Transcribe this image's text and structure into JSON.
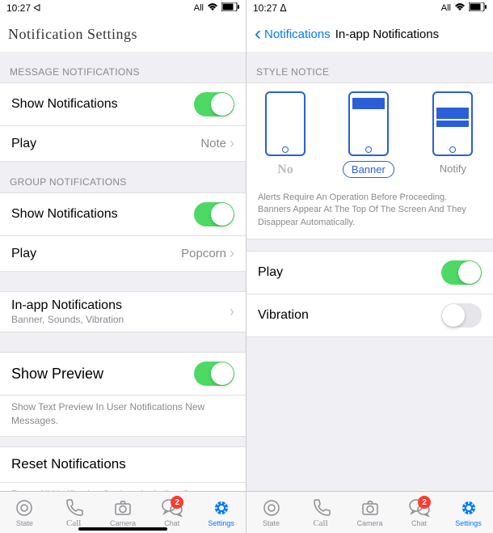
{
  "status": {
    "time_left": "10:27 ᐊ",
    "time_right": "10:27 ᐃ",
    "right": "All"
  },
  "left": {
    "title": "Notification Settings",
    "section1": "MESSAGE NOTIFICATIONS",
    "show_notif1": "Show Notifications",
    "play1_label": "Play",
    "play1_value": "Note",
    "section2": "GROUP NOTIFICATIONS",
    "show_notif2": "Show Notifications",
    "play2_label": "Play",
    "play2_value": "Popcorn",
    "inapp_title": "In-app Notifications",
    "inapp_sub": "Banner, Sounds, Vibration",
    "preview_title": "Show Preview",
    "preview_desc": "Show Text Preview In User Notifications New Messages.",
    "reset_title": "Reset Notifications",
    "reset_desc": "Reset All Notification Settings Including Custom Chat Notification Settings."
  },
  "right": {
    "back": "Notifications",
    "title": "In-app Notifications",
    "style_header": "STYLE NOTICE",
    "opt_no": "No",
    "opt_banner": "Banner",
    "opt_notify": "Notify",
    "style_desc": "Alerts Require An Operation Before Proceeding. Banners Appear At The Top Of The Screen And They Disappear Automatically.",
    "play_label": "Play",
    "vibration_label": "Vibration"
  },
  "tabs": {
    "state": "State",
    "call": "Call",
    "camera": "Camera",
    "chat": "Chat",
    "settings": "Settings",
    "badge": "2"
  }
}
